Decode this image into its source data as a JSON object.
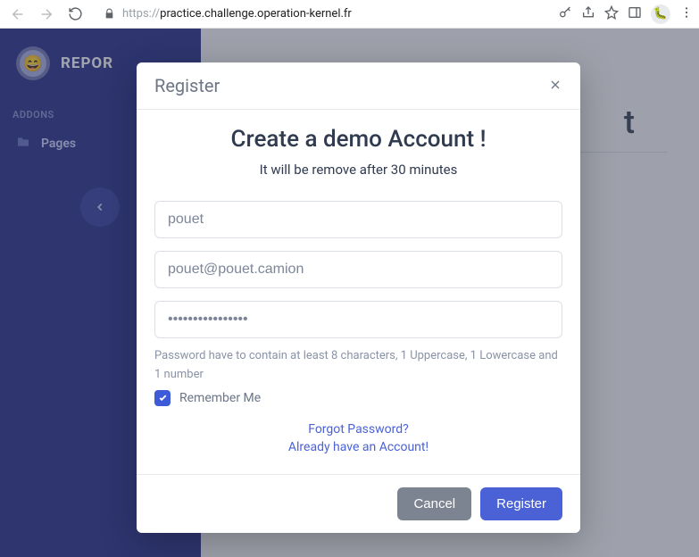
{
  "browser": {
    "url_proto": "https://",
    "url_host": "practice.challenge.operation-kernel.fr"
  },
  "sidebar": {
    "brand": "REPOR",
    "section": "ADDONS",
    "items": [
      {
        "label": "Pages"
      }
    ]
  },
  "main": {
    "heading_fragment": "t"
  },
  "modal": {
    "title": "Register",
    "heading": "Create a demo Account !",
    "subheading": "It will be remove after 30 minutes",
    "username_value": "pouet",
    "email_value": "pouet@pouet.camion",
    "password_value": "••••••••••••••••",
    "password_hint": "Password have to contain at least 8 characters, 1 Uppercase, 1 Lowercase and 1 number",
    "remember_label": "Remember Me",
    "forgot_link": "Forgot Password?",
    "already_link": "Already have an Account!",
    "cancel_label": "Cancel",
    "register_label": "Register"
  }
}
